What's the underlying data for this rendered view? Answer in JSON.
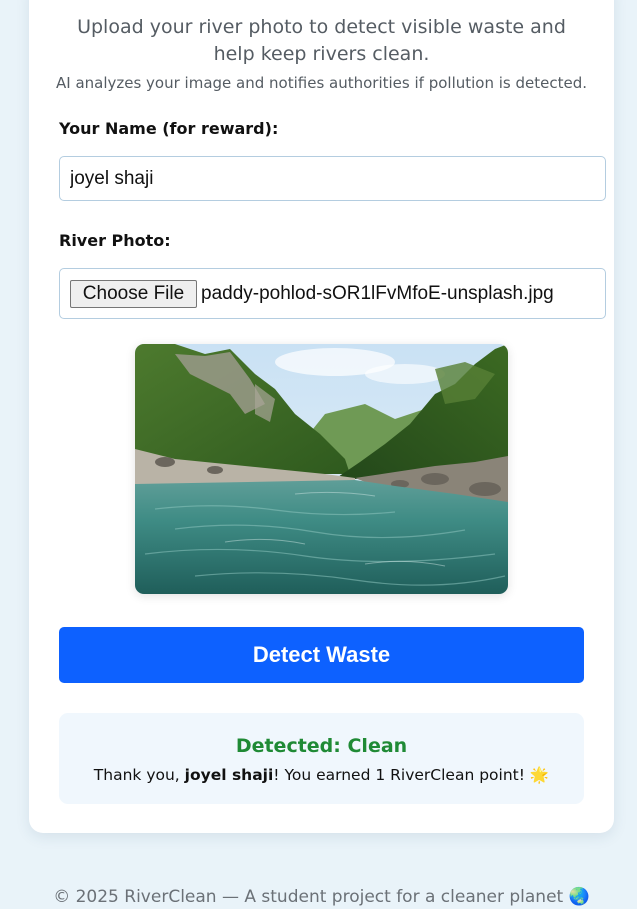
{
  "intro": {
    "subtitle": "Upload your river photo to detect visible waste and help keep rivers clean.",
    "note": "AI analyzes your image and notifies authorities if pollution is detected."
  },
  "form": {
    "name_label": "Your Name (for reward):",
    "name_value": "joyel shaji",
    "photo_label": "River Photo:",
    "choose_file_label": "Choose File",
    "file_name": "paddy-pohlod-sOR1lFvMfoE-unsplash.jpg"
  },
  "actions": {
    "detect_label": "Detect Waste"
  },
  "result": {
    "title": "Detected: Clean",
    "thanks_prefix": "Thank you, ",
    "user": "joyel shaji",
    "thanks_suffix": "! You earned 1 RiverClean point! ",
    "emoji": "🌟"
  },
  "footer": {
    "text": "© 2025 RiverClean — A student project for a cleaner planet 🌏"
  },
  "colors": {
    "accent": "#0d61ff",
    "success": "#1f8a35",
    "page_bg": "#e9f3f9"
  }
}
